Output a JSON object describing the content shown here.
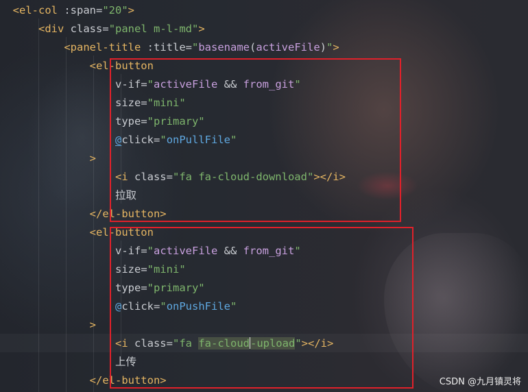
{
  "lines": [
    {
      "indent": "  ",
      "parts": [
        [
          "tag",
          "<el-col "
        ],
        [
          "attr",
          ":span"
        ],
        [
          "eq",
          "="
        ],
        [
          "str",
          "\"20\""
        ],
        [
          "tag",
          ">"
        ]
      ]
    },
    {
      "indent": "      ",
      "parts": [
        [
          "tag",
          "<div "
        ],
        [
          "attr",
          "class"
        ],
        [
          "eq",
          "="
        ],
        [
          "str",
          "\"panel m-l-md\""
        ],
        [
          "tag",
          ">"
        ]
      ]
    },
    {
      "indent": "          ",
      "parts": [
        [
          "tag",
          "<panel-title "
        ],
        [
          "attr",
          ":title"
        ],
        [
          "eq",
          "="
        ],
        [
          "str",
          "\""
        ],
        [
          "fn",
          "basename"
        ],
        [
          "txt",
          "("
        ],
        [
          "fn",
          "activeFile"
        ],
        [
          "txt",
          ")"
        ],
        [
          "str",
          "\""
        ],
        [
          "tag",
          ">"
        ]
      ]
    },
    {
      "indent": "              ",
      "parts": [
        [
          "tag",
          "<el-button"
        ]
      ]
    },
    {
      "indent": "                  ",
      "parts": [
        [
          "attr",
          "v-if"
        ],
        [
          "eq",
          "="
        ],
        [
          "str",
          "\""
        ],
        [
          "fn",
          "activeFile"
        ],
        [
          "txt",
          " && "
        ],
        [
          "fn",
          "from_git"
        ],
        [
          "str",
          "\""
        ]
      ]
    },
    {
      "indent": "                  ",
      "parts": [
        [
          "attr",
          "size"
        ],
        [
          "eq",
          "="
        ],
        [
          "str",
          "\"mini\""
        ]
      ]
    },
    {
      "indent": "                  ",
      "parts": [
        [
          "attr",
          "type"
        ],
        [
          "eq",
          "="
        ],
        [
          "str",
          "\"primary\""
        ]
      ]
    },
    {
      "indent": "                  ",
      "parts": [
        [
          "eventul",
          "@"
        ],
        [
          "attr",
          "click"
        ],
        [
          "eq",
          "="
        ],
        [
          "str",
          "\""
        ],
        [
          "event",
          "onPullFile"
        ],
        [
          "str",
          "\""
        ]
      ]
    },
    {
      "indent": "              ",
      "parts": [
        [
          "tag",
          ">"
        ]
      ]
    },
    {
      "indent": "                  ",
      "parts": [
        [
          "tag",
          "<i "
        ],
        [
          "attr",
          "class"
        ],
        [
          "eq",
          "="
        ],
        [
          "str",
          "\"fa fa-cloud-download\""
        ],
        [
          "tag",
          "></i>"
        ]
      ]
    },
    {
      "indent": "                  ",
      "parts": [
        [
          "txt",
          "拉取"
        ]
      ]
    },
    {
      "indent": "              ",
      "parts": [
        [
          "tag",
          "</el-button>"
        ]
      ]
    },
    {
      "indent": "              ",
      "parts": [
        [
          "tag",
          "<el-button"
        ]
      ]
    },
    {
      "indent": "                  ",
      "parts": [
        [
          "attr",
          "v-if"
        ],
        [
          "eq",
          "="
        ],
        [
          "str",
          "\""
        ],
        [
          "fn",
          "activeFile"
        ],
        [
          "txt",
          " && "
        ],
        [
          "fn",
          "from_git"
        ],
        [
          "str",
          "\""
        ]
      ]
    },
    {
      "indent": "                  ",
      "parts": [
        [
          "attr",
          "size"
        ],
        [
          "eq",
          "="
        ],
        [
          "str",
          "\"mini\""
        ]
      ]
    },
    {
      "indent": "                  ",
      "parts": [
        [
          "attr",
          "type"
        ],
        [
          "eq",
          "="
        ],
        [
          "str",
          "\"primary\""
        ]
      ]
    },
    {
      "indent": "                  ",
      "parts": [
        [
          "event",
          "@"
        ],
        [
          "attr",
          "click"
        ],
        [
          "eq",
          "="
        ],
        [
          "str",
          "\""
        ],
        [
          "event",
          "onPushFile"
        ],
        [
          "str",
          "\""
        ]
      ]
    },
    {
      "indent": "              ",
      "parts": [
        [
          "tag",
          ">"
        ]
      ]
    },
    {
      "indent": "                  ",
      "parts": [
        [
          "tag",
          "<i "
        ],
        [
          "attr",
          "class"
        ],
        [
          "eq",
          "="
        ],
        [
          "str",
          "\"fa "
        ],
        [
          "strhl",
          "fa-cloud"
        ],
        [
          "caret",
          ""
        ],
        [
          "strhl",
          "-upload"
        ],
        [
          "str",
          "\""
        ],
        [
          "tag",
          "></i>"
        ]
      ]
    },
    {
      "indent": "                  ",
      "parts": [
        [
          "txt",
          "上传"
        ]
      ]
    },
    {
      "indent": "              ",
      "parts": [
        [
          "tag",
          "</el-button>"
        ]
      ]
    }
  ],
  "watermark": "CSDN @九月镇灵将",
  "colors": {
    "highlight_box": "#e0212a",
    "tag": "#e5b562",
    "string": "#7eb56c",
    "function": "#c8a0de",
    "event": "#5fa8e0"
  }
}
